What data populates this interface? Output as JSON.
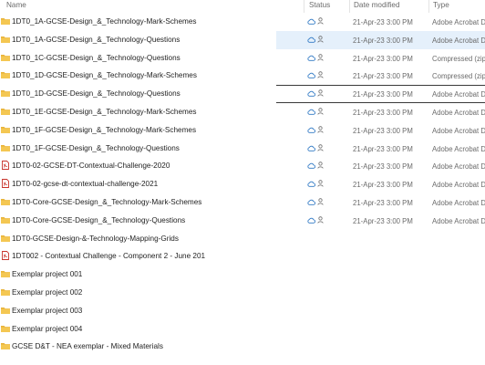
{
  "columns": {
    "name": "Name",
    "status": "Status",
    "date": "Date modified",
    "type": "Type"
  },
  "colors": {
    "folder": "#e8b33a",
    "pdf_red": "#c8332b",
    "cloud_blue": "#2f78c4",
    "selected_bg": "#e5f0fb"
  },
  "rows": [
    {
      "name": "1DT0_1A-GCSE-Design_&_Technology-Mark-Schemes",
      "icon": "folder-icon",
      "status": true,
      "date": "21-Apr-23 3:00 PM",
      "type": "Adobe Acrobat D..."
    },
    {
      "name": "1DT0_1A-GCSE-Design_&_Technology-Questions",
      "icon": "folder-icon",
      "status": true,
      "date": "21-Apr-23 3:00 PM",
      "type": "Adobe Acrobat D..."
    },
    {
      "name": "1DT0_1C-GCSE-Design_&_Technology-Questions",
      "icon": "folder-icon",
      "status": true,
      "date": "21-Apr-23 3:00 PM",
      "type": "Compressed (zipp..."
    },
    {
      "name": "1DT0_1D-GCSE-Design_&_Technology-Mark-Schemes",
      "icon": "folder-icon",
      "status": true,
      "date": "21-Apr-23 3:00 PM",
      "type": "Compressed (zipp..."
    },
    {
      "name": "1DT0_1D-GCSE-Design_&_Technology-Questions",
      "icon": "folder-icon",
      "status": true,
      "date": "21-Apr-23 3:00 PM",
      "type": "Adobe Acrobat D..."
    },
    {
      "name": "1DT0_1E-GCSE-Design_&_Technology-Mark-Schemes",
      "icon": "folder-icon",
      "status": true,
      "date": "21-Apr-23 3:00 PM",
      "type": "Adobe Acrobat D..."
    },
    {
      "name": "1DT0_1F-GCSE-Design_&_Technology-Mark-Schemes",
      "icon": "folder-icon",
      "status": true,
      "date": "21-Apr-23 3:00 PM",
      "type": "Adobe Acrobat D..."
    },
    {
      "name": "1DT0_1F-GCSE-Design_&_Technology-Questions",
      "icon": "folder-icon",
      "status": true,
      "date": "21-Apr-23 3:00 PM",
      "type": "Adobe Acrobat D..."
    },
    {
      "name": "1DT0-02-GCSE-DT-Contextual-Challenge-2020",
      "icon": "pdf-icon",
      "status": true,
      "date": "21-Apr-23 3:00 PM",
      "type": "Adobe Acrobat D..."
    },
    {
      "name": "1DT0-02-gcse-dt-contextual-challenge-2021",
      "icon": "pdf-icon",
      "status": true,
      "date": "21-Apr-23 3:00 PM",
      "type": "Adobe Acrobat D..."
    },
    {
      "name": "1DT0-Core-GCSE-Design_&_Technology-Mark-Schemes",
      "icon": "folder-icon",
      "status": true,
      "date": "21-Apr-23 3:00 PM",
      "type": "Adobe Acrobat D..."
    },
    {
      "name": "1DT0-Core-GCSE-Design_&_Technology-Questions",
      "icon": "folder-icon",
      "status": true,
      "date": "21-Apr-23 3:00 PM",
      "type": "Adobe Acrobat D..."
    },
    {
      "name": "1DT0-GCSE-Design-&-Technology-Mapping-Grids",
      "icon": "folder-icon",
      "status": false,
      "date": "",
      "type": ""
    },
    {
      "name": "1DT002 - Contextual Challenge - Component 2 - June 201",
      "icon": "pdf-icon",
      "status": false,
      "date": "",
      "type": ""
    },
    {
      "name": "Exemplar project 001",
      "icon": "folder-icon",
      "status": false,
      "date": "",
      "type": ""
    },
    {
      "name": "Exemplar project 002",
      "icon": "folder-icon",
      "status": false,
      "date": "",
      "type": ""
    },
    {
      "name": "Exemplar project 003",
      "icon": "folder-icon",
      "status": false,
      "date": "",
      "type": ""
    },
    {
      "name": "Exemplar project 004",
      "icon": "folder-icon",
      "status": false,
      "date": "",
      "type": ""
    },
    {
      "name": "GCSE D&T - NEA exemplar - Mixed Materials",
      "icon": "folder-icon",
      "status": false,
      "date": "",
      "type": ""
    }
  ]
}
